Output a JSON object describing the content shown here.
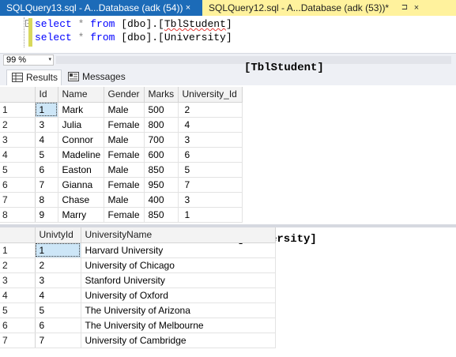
{
  "tabs": [
    {
      "label": "SQLQuery13.sql - A...Database (adk (54))",
      "close": "×",
      "active": true
    },
    {
      "label": "SQLQuery12.sql - A...Database (adk (53))*",
      "pin": "⊐",
      "close": "×",
      "active": false
    }
  ],
  "editor": {
    "line1": {
      "kw1": "select",
      "star": " * ",
      "kw2": "from",
      "obj": " [dbo].[",
      "obj2": "TblStudent",
      "end": "]"
    },
    "line2": {
      "kw1": "select",
      "star": " * ",
      "kw2": "from",
      "obj": " [dbo].[University]"
    },
    "collapse_glyph": "−"
  },
  "zoom": {
    "value": "99 %",
    "arrow": "▾"
  },
  "results_tabs": {
    "results": "Results",
    "messages": "Messages"
  },
  "overlay_labels": {
    "students": "[TblStudent]",
    "university": "[University]"
  },
  "students": {
    "columns": [
      "Id",
      "Name",
      "Gender",
      "Marks",
      "University_Id"
    ],
    "rows": [
      [
        "1",
        "1",
        "Mark",
        "Male",
        "500",
        "2"
      ],
      [
        "2",
        "3",
        "Julia",
        "Female",
        "800",
        "4"
      ],
      [
        "3",
        "4",
        "Connor",
        "Male",
        "700",
        "3"
      ],
      [
        "4",
        "5",
        "Madeline",
        "Female",
        "600",
        "6"
      ],
      [
        "5",
        "6",
        "Easton",
        "Male",
        "850",
        "5"
      ],
      [
        "6",
        "7",
        "Gianna",
        "Female",
        "950",
        "7"
      ],
      [
        "7",
        "8",
        "Chase",
        "Male",
        "400",
        "3"
      ],
      [
        "8",
        "9",
        "Marry",
        "Female",
        "850",
        "1"
      ]
    ]
  },
  "university": {
    "columns": [
      "UnivtyId",
      "UniversityName"
    ],
    "rows": [
      [
        "1",
        "1",
        "Harvard University"
      ],
      [
        "2",
        "2",
        "University of Chicago"
      ],
      [
        "3",
        "3",
        "Stanford University"
      ],
      [
        "4",
        "4",
        "University of Oxford"
      ],
      [
        "5",
        "5",
        "The University of Arizona"
      ],
      [
        "6",
        "6",
        "The University of Melbourne"
      ],
      [
        "7",
        "7",
        "University of Cambridge"
      ]
    ]
  }
}
